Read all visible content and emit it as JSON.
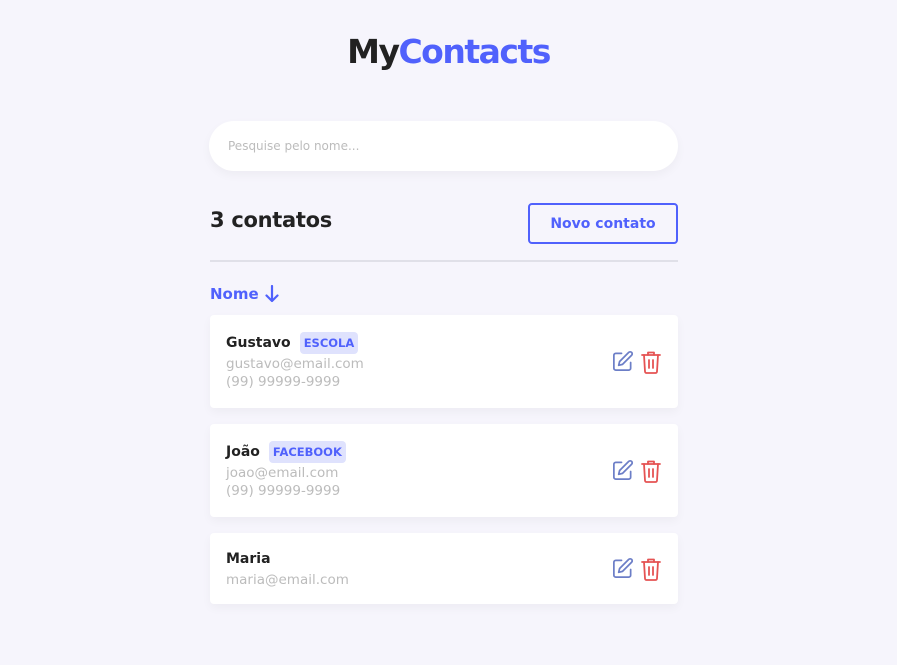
{
  "header": {
    "logo_my": "My",
    "logo_contacts": "Contacts"
  },
  "search": {
    "placeholder": "Pesquise pelo nome...",
    "value": ""
  },
  "summary": {
    "count_label": "3 contatos",
    "new_button_label": "Novo contato"
  },
  "sort": {
    "label": "Nome",
    "direction": "arrow-down-icon"
  },
  "colors": {
    "primary": "#5061fc",
    "danger": "#e55353",
    "edit_icon": "#6c7ec7",
    "background": "#f6f5fc"
  },
  "contacts": [
    {
      "name": "Gustavo",
      "category": "ESCOLA",
      "email": "gustavo@email.com",
      "phone": "(99) 99999-9999"
    },
    {
      "name": "João",
      "category": "FACEBOOK",
      "email": "joao@email.com",
      "phone": "(99) 99999-9999"
    },
    {
      "name": "Maria",
      "category": "",
      "email": "maria@email.com",
      "phone": ""
    }
  ]
}
